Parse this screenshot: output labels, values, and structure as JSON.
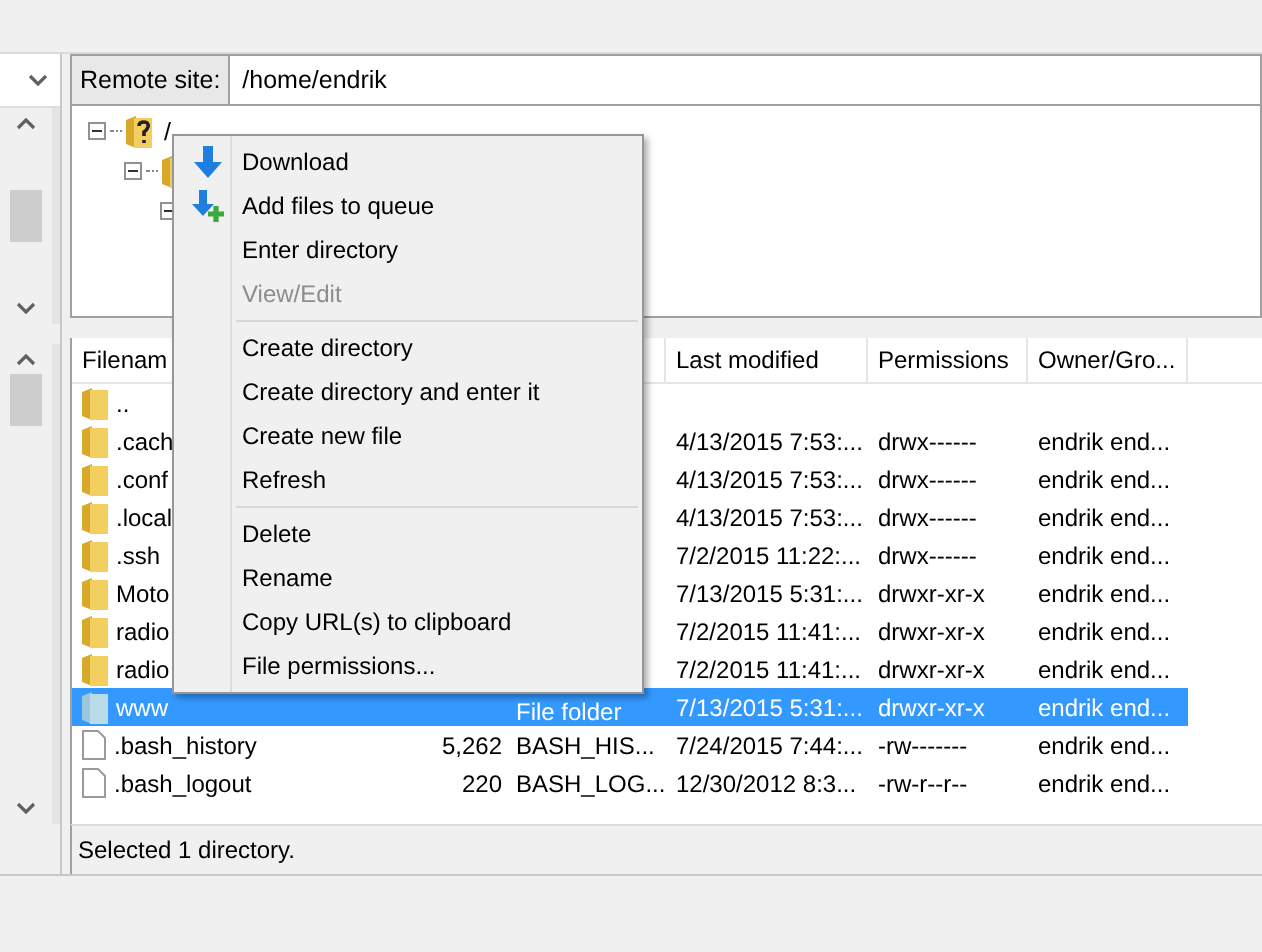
{
  "remote_site": {
    "label": "Remote site:",
    "value": "/home/endrik"
  },
  "tree": [
    {
      "label": "/",
      "expanded": true,
      "children": [
        {
          "expanded": true,
          "children": [
            {
              "expanded": true
            }
          ]
        }
      ]
    }
  ],
  "context_menu": [
    {
      "kind": "download",
      "label": "Download",
      "disabled": false
    },
    {
      "kind": "queue",
      "label": "Add files to queue",
      "disabled": false
    },
    {
      "kind": "item",
      "label": "Enter directory",
      "disabled": false
    },
    {
      "kind": "item",
      "label": "View/Edit",
      "disabled": true
    },
    {
      "kind": "separator"
    },
    {
      "kind": "item",
      "label": "Create directory",
      "disabled": false
    },
    {
      "kind": "item",
      "label": "Create directory and enter it",
      "disabled": false
    },
    {
      "kind": "item",
      "label": "Create new file",
      "disabled": false
    },
    {
      "kind": "item",
      "label": "Refresh",
      "disabled": false
    },
    {
      "kind": "separator"
    },
    {
      "kind": "item",
      "label": "Delete",
      "disabled": false
    },
    {
      "kind": "item",
      "label": "Rename",
      "disabled": false
    },
    {
      "kind": "item",
      "label": "Copy URL(s) to clipboard",
      "disabled": false
    },
    {
      "kind": "item",
      "label": "File permissions...",
      "disabled": false
    }
  ],
  "table": {
    "columns": [
      {
        "label": "Filenam"
      },
      {},
      {},
      {
        "label": "Last modified"
      },
      {
        "label": "Permissions"
      },
      {
        "label": "Owner/Gro..."
      }
    ],
    "rows": [
      {
        "kind": "folder",
        "selected": false,
        "name": ".."
      },
      {
        "kind": "folder",
        "selected": false,
        "name": ".cach",
        "modified": "4/13/2015 7:53:...",
        "permissions": "drwx------",
        "owner": "endrik end..."
      },
      {
        "kind": "folder",
        "selected": false,
        "name": ".conf",
        "modified": "4/13/2015 7:53:...",
        "permissions": "drwx------",
        "owner": "endrik end..."
      },
      {
        "kind": "folder",
        "selected": false,
        "name": ".local",
        "modified": "4/13/2015 7:53:...",
        "permissions": "drwx------",
        "owner": "endrik end..."
      },
      {
        "kind": "folder",
        "selected": false,
        "name": ".ssh",
        "modified": "7/2/2015 11:22:...",
        "permissions": "drwx------",
        "owner": "endrik end..."
      },
      {
        "kind": "folder",
        "selected": false,
        "name": "Moto",
        "modified": "7/13/2015 5:31:...",
        "permissions": "drwxr-xr-x",
        "owner": "endrik end..."
      },
      {
        "kind": "folder",
        "selected": false,
        "name": "radio",
        "modified": "7/2/2015 11:41:...",
        "permissions": "drwxr-xr-x",
        "owner": "endrik end..."
      },
      {
        "kind": "folder",
        "selected": false,
        "name": "radio",
        "modified": "7/2/2015 11:41:...",
        "permissions": "drwxr-xr-x",
        "owner": "endrik end..."
      },
      {
        "kind": "folder",
        "selected": true,
        "name": "www",
        "type": "File folder",
        "modified": "7/13/2015 5:31:...",
        "permissions": "drwxr-xr-x",
        "owner": "endrik end..."
      },
      {
        "kind": "file",
        "selected": false,
        "name": ".bash_history",
        "size": "5,262",
        "type": "BASH_HIS...",
        "modified": "7/24/2015 7:44:...",
        "permissions": "-rw-------",
        "owner": "endrik end..."
      },
      {
        "kind": "file",
        "selected": false,
        "name": ".bash_logout",
        "size": "220",
        "type": "BASH_LOG...",
        "modified": "12/30/2012 8:3...",
        "permissions": "-rw-r--r--",
        "owner": "endrik end..."
      }
    ]
  },
  "status_bar": "Selected 1 directory."
}
